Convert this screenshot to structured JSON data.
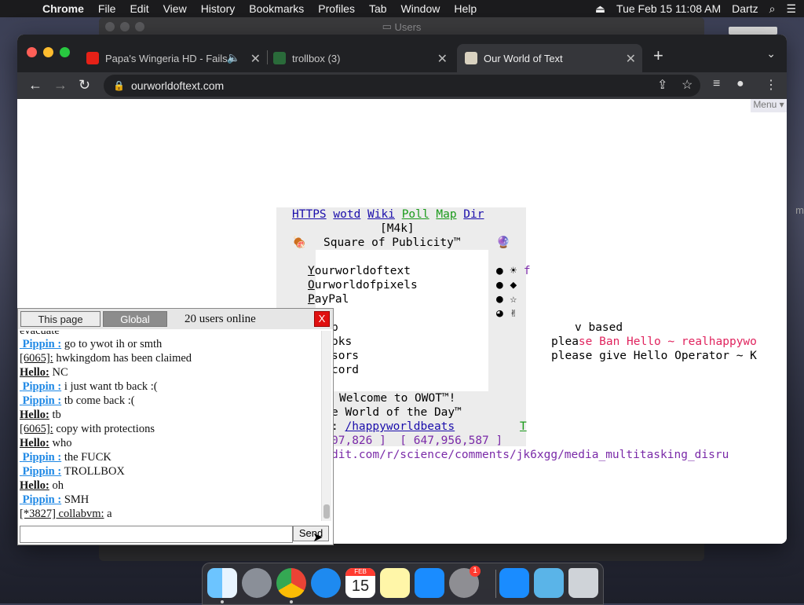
{
  "menubar": {
    "app": "Chrome",
    "items": [
      "File",
      "Edit",
      "View",
      "History",
      "Bookmarks",
      "Profiles",
      "Tab",
      "Window",
      "Help"
    ],
    "datetime": "Tue Feb 15  11:08 AM",
    "user": "Dartz"
  },
  "background_window": {
    "title": "Users"
  },
  "browser": {
    "tabs": [
      {
        "title": "Papa's Wingeria HD - Fails"
      },
      {
        "title": "trollbox (3)"
      },
      {
        "title": "Our World of Text"
      }
    ],
    "url": "ourworldoftext.com",
    "page_menu": "Menu ▾"
  },
  "owot": {
    "nav_links": [
      "HTTPS",
      "wotd",
      "Wiki",
      "Poll",
      "Map",
      "Dir"
    ],
    "m4k": "[M4k]",
    "square_title": "Square of Publicity™",
    "list": [
      {
        "first": "Y",
        "rest": "ourworldoftext"
      },
      {
        "first": "O",
        "rest": "urworldofpixels"
      },
      {
        "first": "P",
        "rest": "ayPal"
      }
    ],
    "partial_lines": [
      "p",
      "oks",
      "sors",
      "cord"
    ],
    "welcome": "Welcome to OWOT™!",
    "world_day": "e World of the Day™",
    "happy_prefix": ":",
    "happy_link": "/happyworldbeats",
    "t_link": "T",
    "coords": "07,826 ]  [ 647,956,587 ]",
    "reddit": "dit.com/r/science/comments/jk6xgg/media_multitasking_disru",
    "v_based": "v based",
    "please1_a": "plea",
    "please1_b": "se Ban Hello ~ realhappywo",
    "please2": "please give Hello Operator ~ K",
    "right_f": "f"
  },
  "chat": {
    "tab_page": "This page",
    "tab_global": "Global",
    "online": "20 users online",
    "close": "X",
    "partial_top": "evacuate",
    "messages": [
      {
        "user": "Pippin :",
        "text": "go to ywot ih or smth"
      },
      {
        "user": "[6065]:",
        "text": "hwkingdom has been claimed"
      },
      {
        "user": "Hello:",
        "text": "NC"
      },
      {
        "user": "Pippin :",
        "text": "i just want tb back :("
      },
      {
        "user": "Pippin :",
        "text": "tb come back :("
      },
      {
        "user": "Hello:",
        "text": "tb"
      },
      {
        "user": "[6065]:",
        "text": "copy with protections"
      },
      {
        "user": "Hello:",
        "text": "who"
      },
      {
        "user": "Pippin :",
        "text": "the FUCK"
      },
      {
        "user": "Pippin :",
        "text": "TROLLBOX"
      },
      {
        "user": "Hello:",
        "text": "oh"
      },
      {
        "user": "Pippin :",
        "text": "SMH"
      },
      {
        "user": "[*3827] collabvm:",
        "text": "a"
      }
    ],
    "input_value": "",
    "send": "Send"
  },
  "dock": {
    "calendar_month": "FEB",
    "calendar_day": "15",
    "badge": "1",
    "apps": [
      "Finder",
      "Launchpad",
      "Google Chrome",
      "Safari",
      "Calendar",
      "Notes",
      "App Store",
      "System Preferences",
      "App Store Downloads",
      "Downloads",
      "Trash"
    ]
  },
  "colors": {
    "tab_red": "#ff5f57",
    "tab_yellow": "#febc2e",
    "tab_green": "#28c840",
    "link": "#1a0dab",
    "chat_user": "#1e88e5"
  }
}
